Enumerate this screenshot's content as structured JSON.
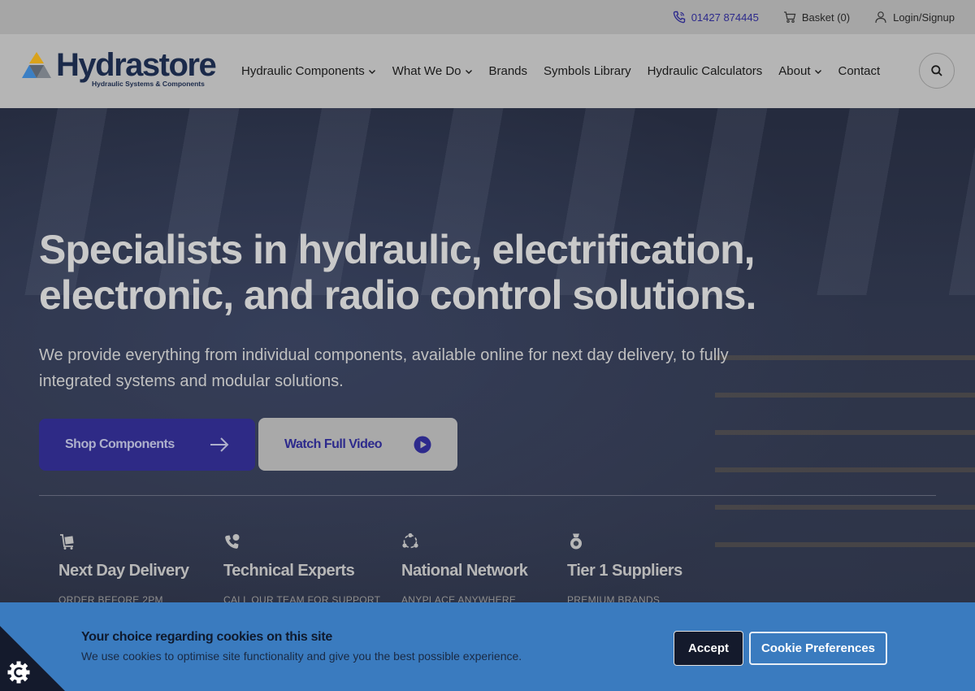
{
  "topbar": {
    "phone": "01427 874445",
    "basket": "Basket (0)",
    "login": "Login/Signup"
  },
  "brand": {
    "name": "Hydrastore",
    "tagline": "Hydraulic Systems & Components"
  },
  "nav": {
    "items": [
      {
        "label": "Hydraulic Components",
        "dropdown": true
      },
      {
        "label": "What We Do",
        "dropdown": true
      },
      {
        "label": "Brands",
        "dropdown": false
      },
      {
        "label": "Symbols Library",
        "dropdown": false
      },
      {
        "label": "Hydraulic Calculators",
        "dropdown": false
      },
      {
        "label": "About",
        "dropdown": true
      },
      {
        "label": "Contact",
        "dropdown": false
      }
    ]
  },
  "hero": {
    "title": "Specialists in hydraulic, electrification, electronic, and radio control solutions.",
    "subtitle": "We provide everything from individual components, available online for next day delivery, to fully integrated systems and modular solutions.",
    "primary_cta": "Shop Components",
    "secondary_cta": "Watch Full Video"
  },
  "features": [
    {
      "icon": "delivery-cart-icon",
      "title": "Next Day Delivery",
      "subtitle": "ORDER BEFORE 2PM"
    },
    {
      "icon": "phone-support-icon",
      "title": "Technical Experts",
      "subtitle": "CALL OUR TEAM FOR SUPPORT"
    },
    {
      "icon": "network-icon",
      "title": "National Network",
      "subtitle": "ANYPLACE ANYWHERE"
    },
    {
      "icon": "medal-icon",
      "title": "Tier 1 Suppliers",
      "subtitle": "PREMIUM BRANDS"
    }
  ],
  "cookie": {
    "title": "Your choice regarding cookies on this site",
    "text": "We use cookies to optimise site functionality and give you the best possible experience.",
    "accept": "Accept",
    "preferences": "Cookie Preferences"
  },
  "colors": {
    "brand_primary": "#2e2a86",
    "cookie_bar": "#3a7bbf",
    "navy": "#1b2a4a"
  }
}
